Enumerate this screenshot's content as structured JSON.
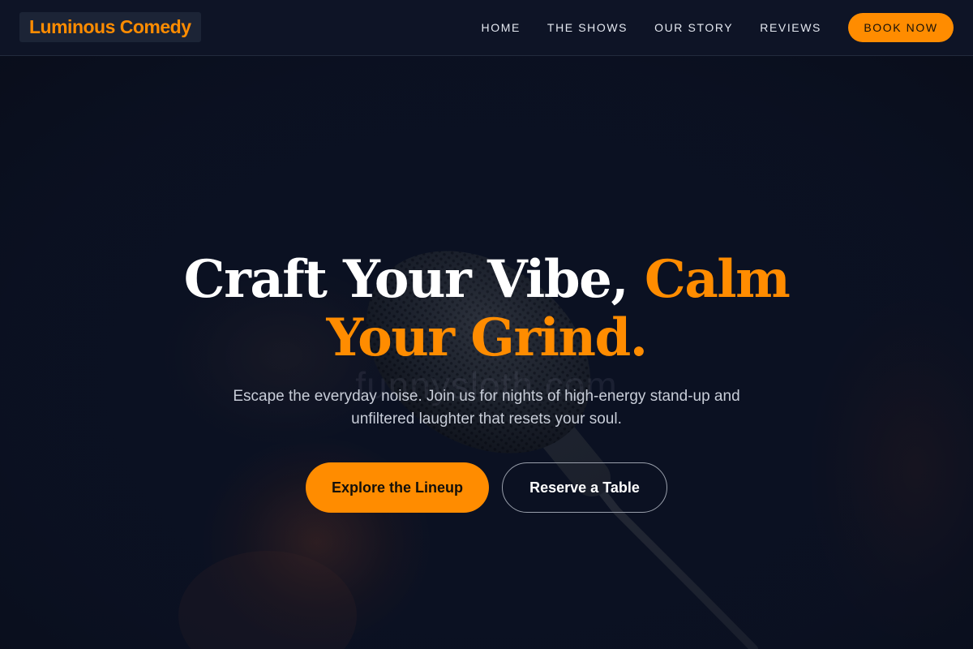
{
  "brand": {
    "name": "Luminous Comedy"
  },
  "nav": {
    "items": [
      {
        "label": "HOME"
      },
      {
        "label": "THE SHOWS"
      },
      {
        "label": "OUR STORY"
      },
      {
        "label": "REVIEWS"
      }
    ],
    "cta_label": "BOOK NOW"
  },
  "hero": {
    "title_main": "Craft Your Vibe, ",
    "title_accent": "Calm Your Grind.",
    "subtitle": "Escape the everyday noise. Join us for nights of high-energy stand-up and unfiltered laughter that resets your soul.",
    "primary_button": "Explore the Lineup",
    "secondary_button": "Reserve a Table",
    "background_image": "microphone-photo",
    "watermark": "funnysloth.com"
  },
  "colors": {
    "accent": "#ff8c00",
    "header_bg": "#0e1426",
    "page_bg": "#0b1020",
    "text_light": "#ffffff",
    "text_muted": "#c8cdd8"
  }
}
